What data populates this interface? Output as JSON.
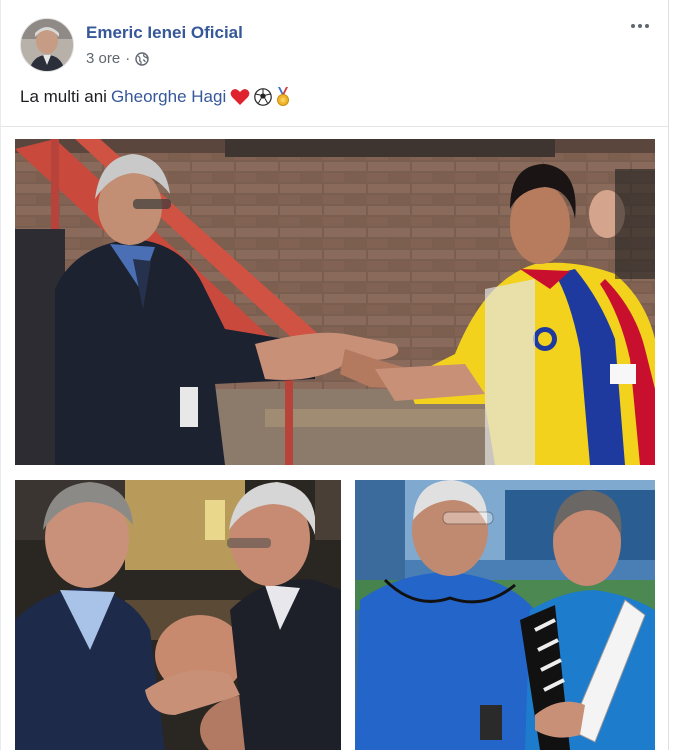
{
  "post": {
    "author": "Emeric Ienei Oficial",
    "time": "3 ore",
    "separator": "·",
    "privacy_icon": "globe-icon",
    "more_icon": "more-options-icon",
    "text_prefix": "La multi ani",
    "mention": "Gheorghe Hagi",
    "emojis": [
      "heart-emoji",
      "soccer-ball-emoji",
      "medal-emoji"
    ]
  },
  "photos": [
    {
      "name": "photo-handshake"
    },
    {
      "name": "photo-conversation"
    },
    {
      "name": "photo-training"
    }
  ],
  "colors": {
    "author_link": "#365899",
    "meta_text": "#606770",
    "romania_yellow": "#f2d21c",
    "romania_blue": "#1f3a9e",
    "romania_red": "#c8102e"
  }
}
